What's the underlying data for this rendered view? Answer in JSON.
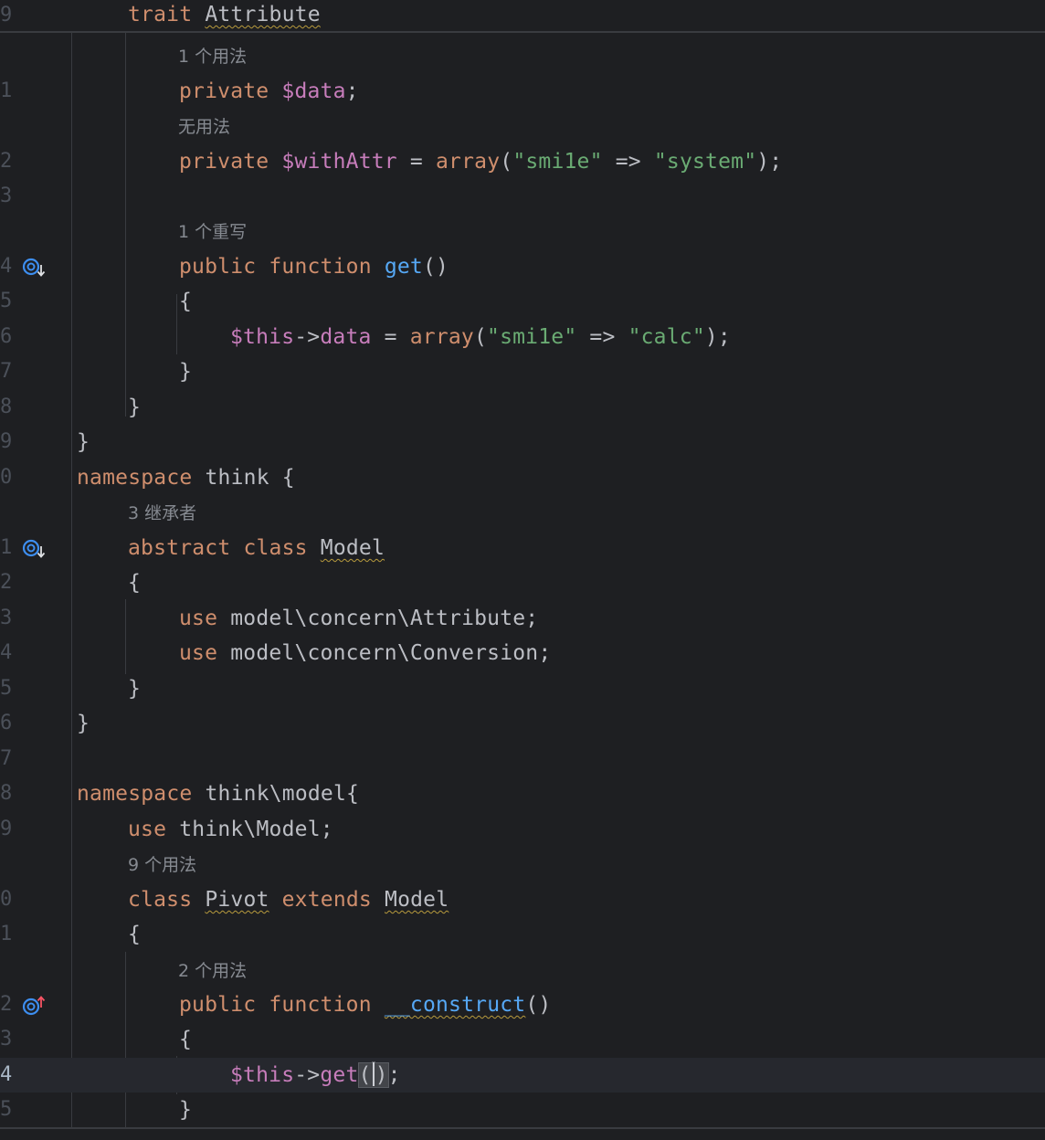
{
  "sticky": {
    "line_no": "9",
    "kw": "trait",
    "name": "Attribute"
  },
  "lines": {
    "l1": {
      "no": "",
      "hint": "1 个用法"
    },
    "l2": {
      "no": "1",
      "kw": "private",
      "var": "$data",
      "end": ";"
    },
    "l3": {
      "no": "",
      "hint": "无用法"
    },
    "l4": {
      "no": "2",
      "kw": "private",
      "var": "$withAttr",
      "op": " = ",
      "fn": "array",
      "open": "(",
      "str1": "\"smi1e\"",
      "arrow": " => ",
      "str2": "\"system\"",
      "close": ");"
    },
    "l5": {
      "no": "3"
    },
    "l6": {
      "no": "",
      "hint": "1 个重写"
    },
    "l7": {
      "no": "4",
      "kw1": "public",
      "kw2": "function",
      "fn": "get",
      "paren": "()"
    },
    "l8": {
      "no": "5",
      "text": "{"
    },
    "l9": {
      "no": "6",
      "var": "$this",
      "arrow": "->",
      "prop": "data",
      "op": " = ",
      "fn": "array",
      "open": "(",
      "str1": "\"smi1e\"",
      "arrow2": " => ",
      "str2": "\"calc\"",
      "close": ");"
    },
    "l10": {
      "no": "7",
      "text": "}"
    },
    "l11": {
      "no": "8",
      "text": "}"
    },
    "l12": {
      "no": "9",
      "text": "}"
    },
    "l13": {
      "no": "0",
      "kw": "namespace",
      "name": "think {"
    },
    "l14": {
      "no": "",
      "hint": "3 继承者"
    },
    "l15": {
      "no": "1",
      "kw1": "abstract",
      "kw2": "class",
      "name": "Model"
    },
    "l16": {
      "no": "2",
      "text": "{"
    },
    "l17": {
      "no": "3",
      "kw": "use",
      "path": "model\\concern\\Attribute;"
    },
    "l18": {
      "no": "4",
      "kw": "use",
      "path": "model\\concern\\Conversion;"
    },
    "l19": {
      "no": "5",
      "text": "}"
    },
    "l20": {
      "no": "6",
      "text": "}"
    },
    "l21": {
      "no": "7"
    },
    "l22": {
      "no": "8",
      "kw": "namespace",
      "name": "think\\model{"
    },
    "l23": {
      "no": "9",
      "kw": "use",
      "path": "think\\Model;"
    },
    "l24": {
      "no": "",
      "hint": "9 个用法"
    },
    "l25": {
      "no": "0",
      "kw1": "class",
      "name1": "Pivot",
      "kw2": "extends",
      "name2": "Model"
    },
    "l26": {
      "no": "1",
      "text": "{"
    },
    "l27": {
      "no": "",
      "hint": "2 个用法"
    },
    "l28": {
      "no": "2",
      "kw1": "public",
      "kw2": "function",
      "fn": "__construct",
      "paren": "()"
    },
    "l29": {
      "no": "3",
      "text": "{"
    },
    "l30": {
      "no": "4",
      "var": "$this",
      "arrow": "->",
      "fn": "get",
      "open": "(",
      "close": ")",
      "end": ";"
    },
    "l31": {
      "no": "5",
      "text": "}"
    }
  },
  "icons": {
    "l7": "implemented-down-icon",
    "l15": "implemented-down-icon",
    "l28": "override-up-icon"
  },
  "colors": {
    "background": "#1e1f22",
    "keyword": "#cf8e6d",
    "variable": "#c77dbb",
    "string": "#6aab73",
    "function": "#56a8f5",
    "text": "#bcbec4",
    "hint": "#868a91",
    "line_number": "#4b5059"
  }
}
